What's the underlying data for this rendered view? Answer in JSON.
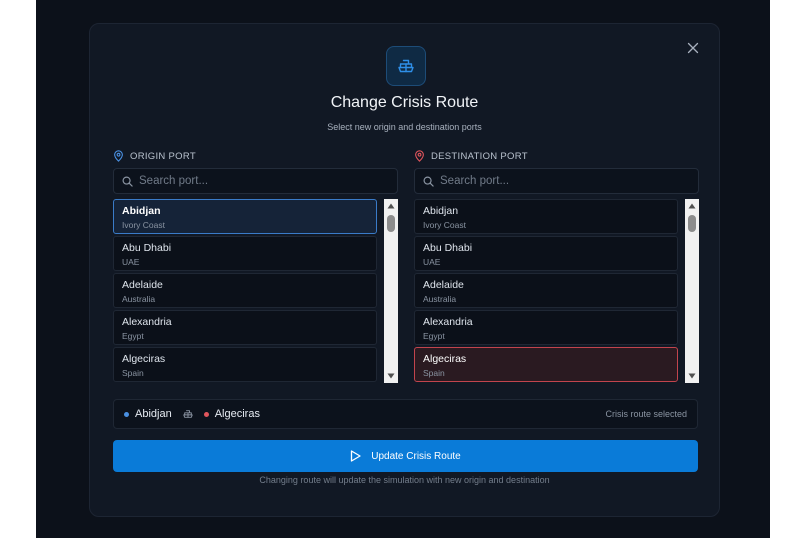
{
  "modal": {
    "title": "Change Crisis Route",
    "subtitle": "Select new origin and destination ports",
    "header_icon": "ship-icon",
    "close_icon": "close-icon"
  },
  "origin": {
    "label": "ORIGIN PORT",
    "icon": "map-pin-icon",
    "accent": "#4a90e2",
    "search_placeholder": "Search port...",
    "selected": "Abidjan",
    "ports": [
      {
        "city": "Abidjan",
        "country": "Ivory Coast"
      },
      {
        "city": "Abu Dhabi",
        "country": "UAE"
      },
      {
        "city": "Adelaide",
        "country": "Australia"
      },
      {
        "city": "Alexandria",
        "country": "Egypt"
      },
      {
        "city": "Algeciras",
        "country": "Spain"
      }
    ]
  },
  "destination": {
    "label": "DESTINATION PORT",
    "icon": "map-pin-icon",
    "accent": "#e0555c",
    "search_placeholder": "Search port...",
    "selected": "Algeciras",
    "ports": [
      {
        "city": "Abidjan",
        "country": "Ivory Coast"
      },
      {
        "city": "Abu Dhabi",
        "country": "UAE"
      },
      {
        "city": "Adelaide",
        "country": "Australia"
      },
      {
        "city": "Alexandria",
        "country": "Egypt"
      },
      {
        "city": "Algeciras",
        "country": "Spain"
      }
    ]
  },
  "summary": {
    "origin": "Abidjan",
    "destination": "Algeciras",
    "status": "Crisis route selected"
  },
  "action": {
    "label": "Update Crisis Route",
    "icon": "play-icon",
    "color": "#0a7bd8",
    "footnote": "Changing route will update the simulation with new origin and destination"
  }
}
